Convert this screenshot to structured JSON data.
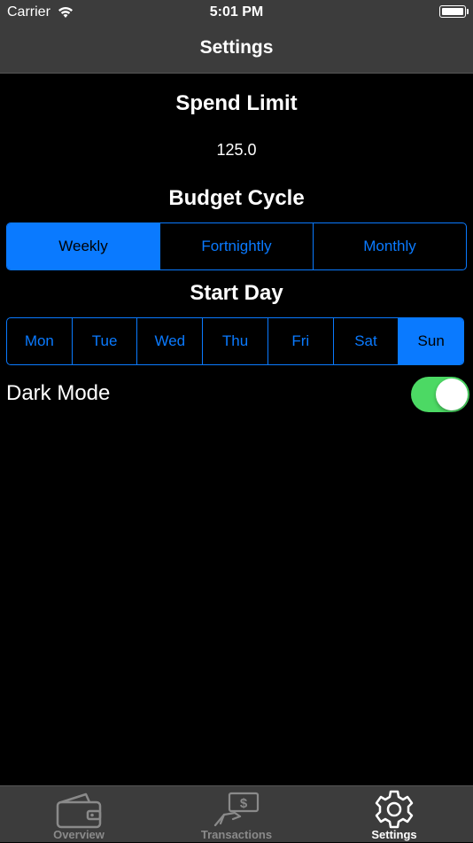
{
  "status_bar": {
    "carrier": "Carrier",
    "time": "5:01 PM"
  },
  "nav": {
    "title": "Settings"
  },
  "spend_limit": {
    "title": "Spend Limit",
    "value": "125.0"
  },
  "budget_cycle": {
    "title": "Budget Cycle",
    "options": [
      "Weekly",
      "Fortnightly",
      "Monthly"
    ],
    "selected": "Weekly"
  },
  "start_day": {
    "title": "Start Day",
    "options": [
      "Mon",
      "Tue",
      "Wed",
      "Thu",
      "Fri",
      "Sat",
      "Sun"
    ],
    "selected": "Sun"
  },
  "dark_mode": {
    "label": "Dark Mode",
    "enabled": true
  },
  "tab_bar": {
    "tabs": [
      {
        "label": "Overview",
        "icon": "wallet-icon",
        "active": false
      },
      {
        "label": "Transactions",
        "icon": "money-hand-icon",
        "active": false
      },
      {
        "label": "Settings",
        "icon": "gear-icon",
        "active": true
      }
    ]
  },
  "colors": {
    "accent": "#0a7aff",
    "toggle_on": "#4cd964",
    "bar_background": "#3c3c3c",
    "background": "#000000"
  }
}
